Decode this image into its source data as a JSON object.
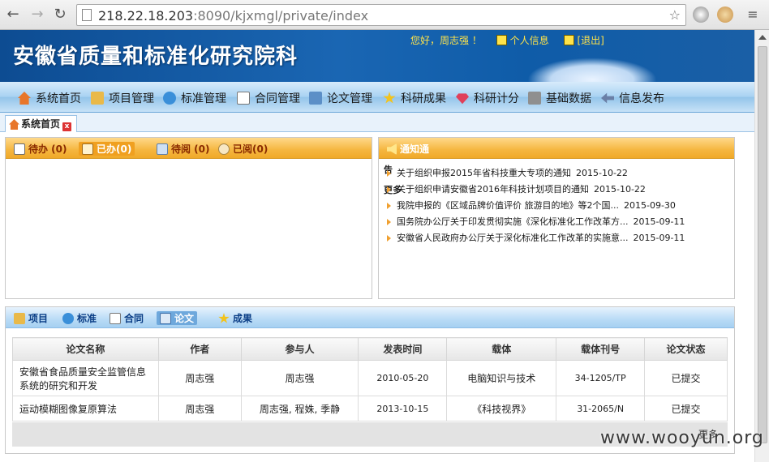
{
  "browser": {
    "url_host": "218.22.18.203",
    "url_rest": ":8090/kjxmgl/private/index"
  },
  "header": {
    "site_title": "安徽省质量和标准化研究院科",
    "greeting": "您好，周志强 ！",
    "profile_link": "个人信息",
    "logout_link": "[退出]"
  },
  "menu": [
    {
      "label": "系统首页",
      "icon": "home-icon",
      "color": "#e8762a"
    },
    {
      "label": "项目管理",
      "icon": "box-icon",
      "color": "#e9b949"
    },
    {
      "label": "标准管理",
      "icon": "globe-icon",
      "color": "#3a8fd9"
    },
    {
      "label": "合同管理",
      "icon": "document-icon",
      "color": "#8a8a8a"
    },
    {
      "label": "论文管理",
      "icon": "edit-icon",
      "color": "#5c8fc7"
    },
    {
      "label": "科研成果",
      "icon": "star-icon",
      "color": "#f2c31d"
    },
    {
      "label": "科研计分",
      "icon": "gem-icon",
      "color": "#e0405a"
    },
    {
      "label": "基础数据",
      "icon": "database-icon",
      "color": "#8f8f8f"
    },
    {
      "label": "信息发布",
      "icon": "arrow-left-icon",
      "color": "#6a7fa6"
    }
  ],
  "tab": {
    "label": "系统首页"
  },
  "todo_panel": {
    "tabs": [
      "待办 (0)",
      "已办(0)",
      "待阅 (0)",
      "已阅(0)"
    ]
  },
  "notice_panel": {
    "title": "通知通",
    "side_mark_1": "告",
    "side_mark_2": "更多",
    "items": [
      {
        "title": "关于组织申报2015年省科技重大专项的通知",
        "date": "2015-10-22"
      },
      {
        "title": "关于组织申请安徽省2016年科技计划项目的通知",
        "date": "2015-10-22"
      },
      {
        "title": "我院申报的《区域品牌价值评价 旅游目的地》等2个国...",
        "date": "2015-09-30"
      },
      {
        "title": "国务院办公厅关于印发贯彻实施《深化标准化工作改革方...",
        "date": "2015-09-11"
      },
      {
        "title": "安徽省人民政府办公厅关于深化标准化工作改革的实施意...",
        "date": "2015-09-11"
      }
    ]
  },
  "bottom_panel": {
    "tabs": [
      "项目",
      "标准",
      "合同",
      "论文",
      "成果"
    ],
    "columns": [
      "论文名称",
      "作者",
      "参与人",
      "发表时间",
      "载体",
      "载体刊号",
      "论文状态"
    ],
    "rows": [
      [
        "安徽省食品质量安全监管信息系统的研究和开发",
        "周志强",
        "周志强",
        "2010-05-20",
        "电脑知识与技术",
        "34-1205/TP",
        "已提交"
      ],
      [
        "运动模糊图像复原算法",
        "周志强",
        "周志强, 程姝, 季静",
        "2013-10-15",
        "《科技视界》",
        "31-2065/N",
        "已提交"
      ]
    ],
    "more_link": "更多"
  },
  "watermark": "www.wooyun.org"
}
